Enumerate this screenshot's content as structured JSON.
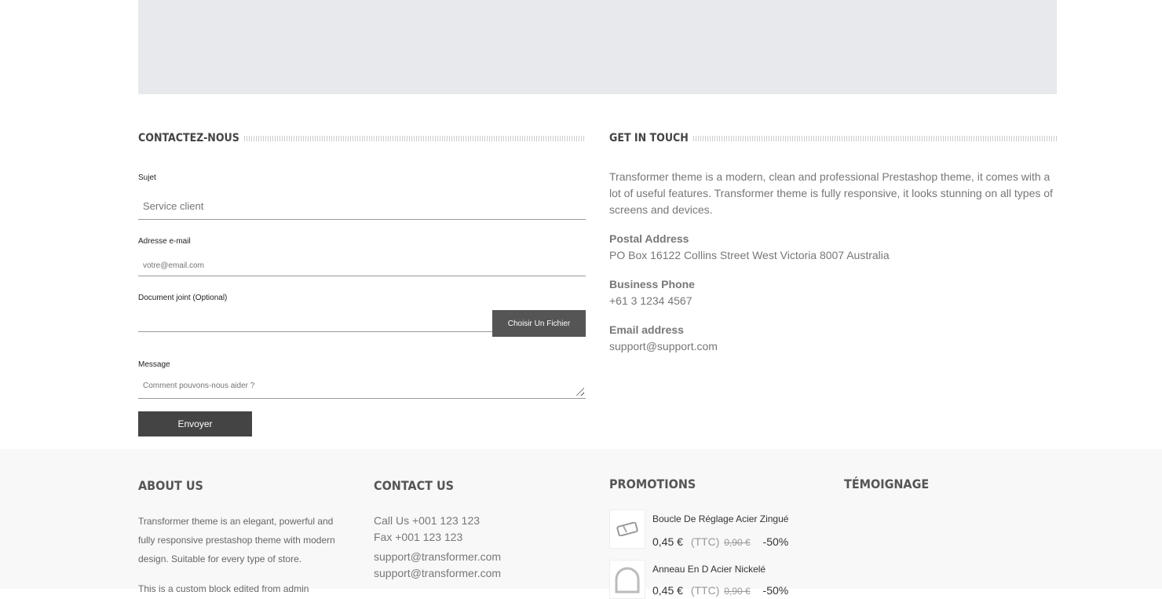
{
  "map": {},
  "contact_form": {
    "title": "CONTACTEZ-NOUS",
    "subject_label": "Sujet",
    "subject_placeholder": "Service client",
    "email_label": "Adresse e-mail",
    "email_placeholder": "votre@email.com",
    "attachment_label": "Document joint (Optional)",
    "file_button": "Choisir Un Fichier",
    "message_label": "Message",
    "message_placeholder": "Comment pouvons-nous aider ?",
    "submit_label": "Envoyer"
  },
  "get_in_touch": {
    "title": "GET IN TOUCH",
    "intro": "Transformer theme is a modern, clean and professional Prestashop theme, it comes with a lot of useful features. Transformer theme is fully responsive, it looks stunning on all types of screens and devices.",
    "postal_label": "Postal Address",
    "postal_value": "PO Box 16122 Collins Street West Victoria 8007 Australia",
    "phone_label": "Business Phone",
    "phone_value": "+61 3 1234 4567",
    "email_label": "Email address",
    "email_value": "support@support.com"
  },
  "footer": {
    "about": {
      "title": "ABOUT US",
      "text": "Transformer theme is an elegant, powerful and fully responsive prestashop theme with modern design. Suitable for every type of store.",
      "text2": "This is a custom block edited from admin"
    },
    "contact": {
      "title": "CONTACT US",
      "call": "Call Us +001 123 123",
      "fax": "Fax +001 123 123",
      "email1": "support@transformer.com",
      "email2": "support@transformer.com"
    },
    "promotions": {
      "title": "PROMOTIONS",
      "items": [
        {
          "name": "Boucle De Réglage Acier Zingué",
          "price": "0,45 €",
          "tax": "(TTC)",
          "old_price": "0,90 €",
          "discount": "-50%",
          "icon": "buckle-icon"
        },
        {
          "name": "Anneau En D Acier Nickelé",
          "price": "0,45 €",
          "tax": "(TTC)",
          "old_price": "0,90 €",
          "discount": "-50%",
          "icon": "d-ring-icon"
        }
      ]
    },
    "testimonial": {
      "title": "TÉMOIGNAGE"
    }
  }
}
